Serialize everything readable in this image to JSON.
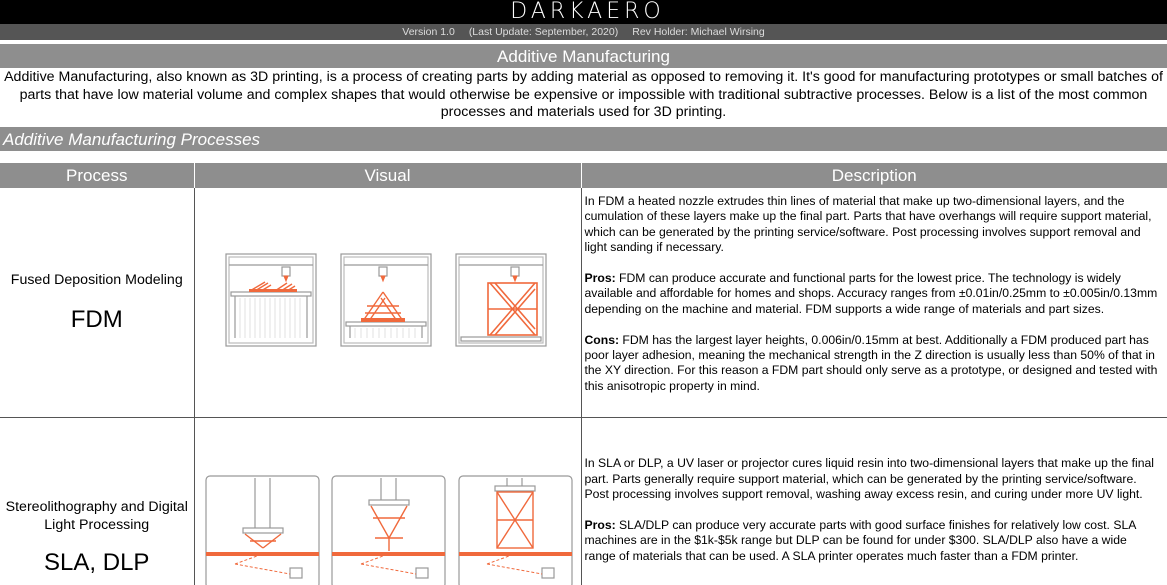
{
  "header": {
    "logo_text": "DARKAERO",
    "version": "Version 1.0",
    "last_update": "(Last Update: September, 2020)",
    "rev_holder": "Rev Holder: Michael Wirsing"
  },
  "section": {
    "title": "Additive Manufacturing",
    "intro": "Additive Manufacturing, also known as 3D printing, is a process of creating parts by adding material as opposed to removing it. It's good for manufacturing prototypes or small batches of parts that have low material volume and complex shapes that would otherwise be expensive or impossible with traditional subtractive processes. Below is a list of the most common processes and materials used for 3D printing.",
    "subheader": "Additive Manufacturing Processes"
  },
  "table": {
    "headers": [
      "Process",
      "Visual",
      "Description"
    ],
    "rows": [
      {
        "name": "Fused Deposition Modeling",
        "abbr": "FDM",
        "desc_intro": "In FDM a heated nozzle extrudes thin lines of material that make up two-dimensional layers, and the cumulation of these layers make up the final part. Parts that have overhangs will require support material, which can be generated by the printing service/software. Post processing involves support removal and light sanding if necessary.",
        "pros_label": "Pros:",
        "pros_text": " FDM can produce accurate and functional parts for the lowest price. The technology is widely available and affordable for homes and shops. Accuracy ranges from ±0.01in/0.25mm to ±0.005in/0.13mm depending on the machine and material. FDM supports a wide range of materials and part sizes.",
        "cons_label": "Cons:",
        "cons_text": " FDM has the largest layer heights, 0.006in/0.15mm at best. Additionally a FDM produced part has poor layer adhesion, meaning the mechanical strength in the Z direction is usually less than 50% of that in the XY direction. For this reason a FDM part should only serve as a prototype, or designed and tested with this anisotropic property in mind."
      },
      {
        "name": "Stereolithography and Digital Light Processing",
        "abbr": "SLA, DLP",
        "desc_intro": "In SLA or DLP, a UV laser or projector cures liquid resin into two-dimensional layers that make up the final part. Parts generally require support material, which can be generated by the printing service/software. Post processing involves support removal, washing away excess resin, and curing under more UV light.",
        "pros_label": "Pros:",
        "pros_text": " SLA/DLP can produce very accurate parts with good surface finishes for relatively low cost. SLA machines are in the $1k-$5k range but DLP can be found for under $300. SLA/DLP also have a wide range of materials that can be used. A SLA printer operates much faster than a FDM printer."
      }
    ]
  },
  "colors": {
    "accent_orange": "#f0693c",
    "header_gray": "#8e8e8e",
    "top_black": "#000000"
  }
}
